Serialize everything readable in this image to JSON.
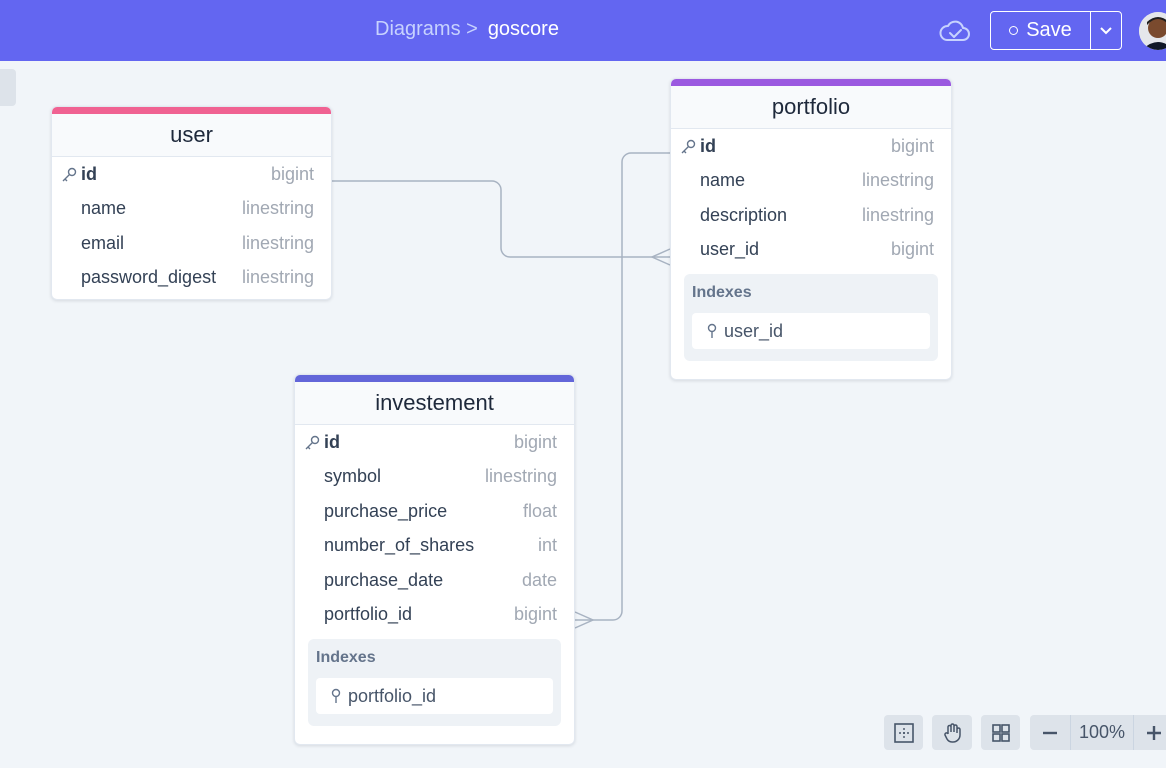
{
  "header": {
    "breadcrumb_parent": "Diagrams >",
    "breadcrumb_current": "goscore",
    "save_label": "Save",
    "accent_color": "#6366f1"
  },
  "tables": {
    "user": {
      "name": "user",
      "accent": "#f06292",
      "fields": [
        {
          "name": "id",
          "type": "bigint",
          "pk": true
        },
        {
          "name": "name",
          "type": "linestring"
        },
        {
          "name": "email",
          "type": "linestring"
        },
        {
          "name": "password_digest",
          "type": "linestring"
        }
      ]
    },
    "portfolio": {
      "name": "portfolio",
      "accent": "#9b59e0",
      "fields": [
        {
          "name": "id",
          "type": "bigint",
          "pk": true
        },
        {
          "name": "name",
          "type": "linestring"
        },
        {
          "name": "description",
          "type": "linestring"
        },
        {
          "name": "user_id",
          "type": "bigint"
        }
      ],
      "indexes_title": "Indexes",
      "indexes": [
        "user_id"
      ]
    },
    "investement": {
      "name": "investement",
      "accent": "#6366d9",
      "fields": [
        {
          "name": "id",
          "type": "bigint",
          "pk": true
        },
        {
          "name": "symbol",
          "type": "linestring"
        },
        {
          "name": "purchase_price",
          "type": "float"
        },
        {
          "name": "number_of_shares",
          "type": "int"
        },
        {
          "name": "purchase_date",
          "type": "date"
        },
        {
          "name": "portfolio_id",
          "type": "bigint"
        }
      ],
      "indexes_title": "Indexes",
      "indexes": [
        "portfolio_id"
      ]
    }
  },
  "toolbar": {
    "zoom_value": "100%",
    "icons": [
      "fit-view-icon",
      "pan-hand-icon",
      "grid-icon",
      "zoom-out-icon",
      "zoom-in-icon"
    ]
  }
}
